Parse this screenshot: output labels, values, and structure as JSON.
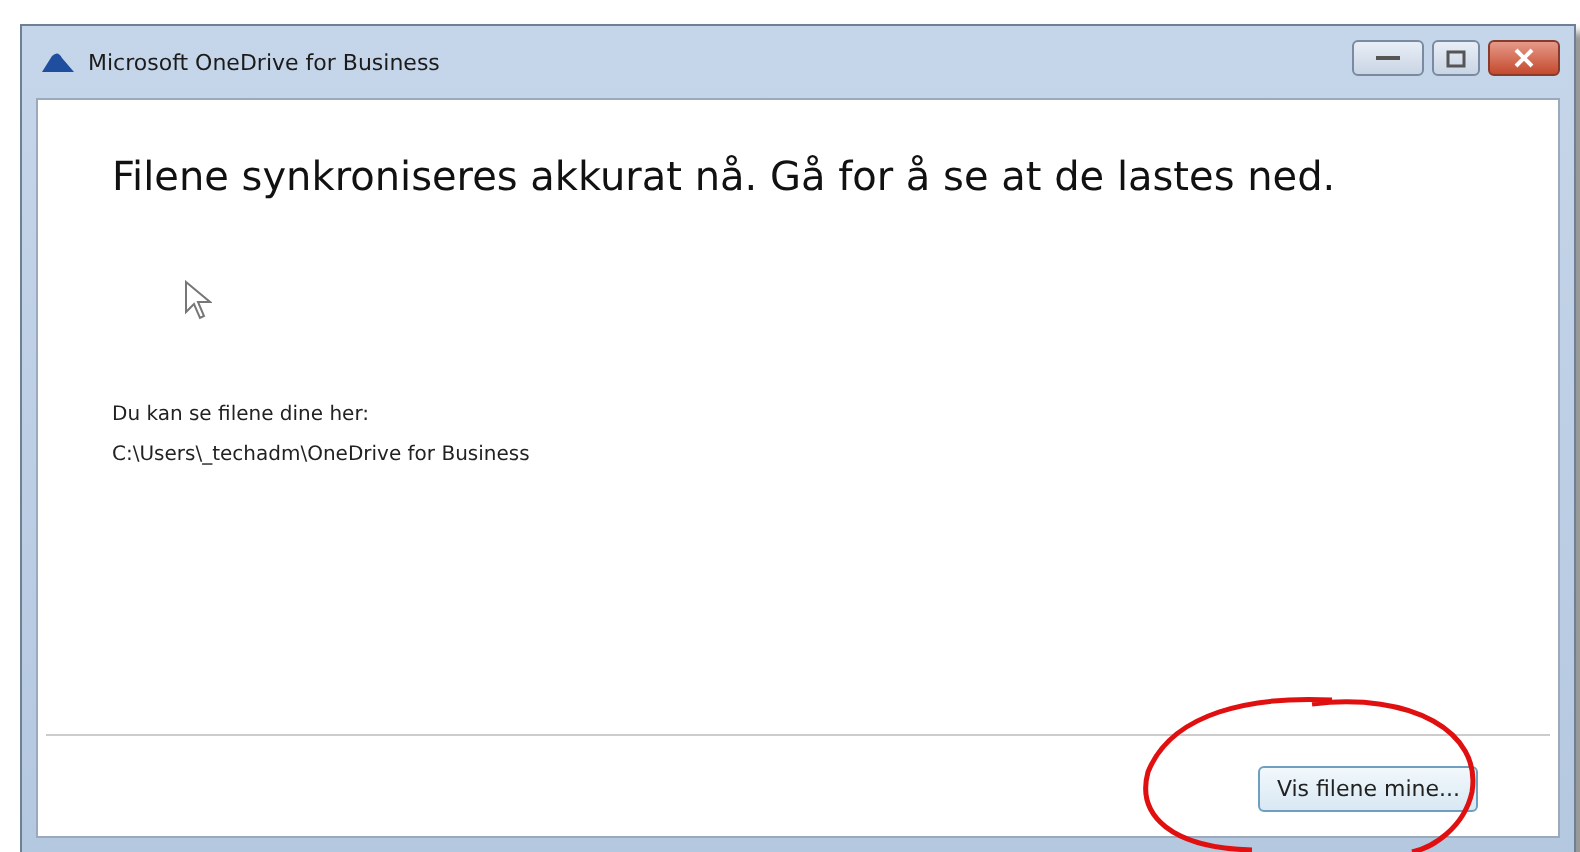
{
  "window": {
    "title": "Microsoft OneDrive for Business"
  },
  "heading": "Filene synkroniseres akkurat nå. Gå for å se at de lastes ned.",
  "info": {
    "label": "Du kan se filene dine her:",
    "path": "C:\\Users\\_techadm\\OneDrive for Business"
  },
  "buttons": [
    "Vis filene mine..."
  ]
}
